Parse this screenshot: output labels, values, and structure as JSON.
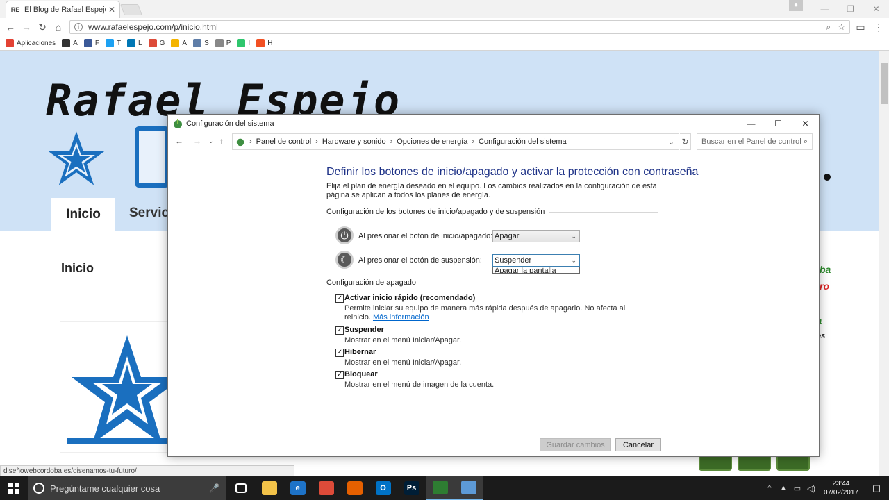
{
  "browser": {
    "tab_title": "El Blog de Rafael Espejo",
    "tab_favicon": "RE",
    "url": "www.rafaelespejo.com/p/inicio.html",
    "bookmarks": [
      {
        "label": "Aplicaciones",
        "icon": "apps-grid-icon",
        "color": "#e34234"
      },
      {
        "label": "A",
        "icon": "circle-a-icon",
        "color": "#333333"
      },
      {
        "label": "F",
        "icon": "facebook-icon",
        "color": "#3b5998"
      },
      {
        "label": "T",
        "icon": "twitter-icon",
        "color": "#1da1f2"
      },
      {
        "label": "L",
        "icon": "linkedin-icon",
        "color": "#0077b5"
      },
      {
        "label": "G",
        "icon": "google-plus-icon",
        "color": "#dd4b39"
      },
      {
        "label": "A",
        "icon": "analytics-icon",
        "color": "#f4b400"
      },
      {
        "label": "S",
        "icon": "search-console-icon",
        "color": "#5f7ea8"
      },
      {
        "label": "P",
        "icon": "page-icon",
        "color": "#888888"
      },
      {
        "label": "I",
        "icon": "pixabay-icon",
        "color": "#2ec66d"
      },
      {
        "label": "H",
        "icon": "windows-icon",
        "color": "#f25022"
      }
    ],
    "status_url": "diseñowebcordoba.es/disenamos-tu-futuro/"
  },
  "website": {
    "logo_text": "Rafael Espejo",
    "nav_active": "Inicio",
    "nav_next": "Servic",
    "page_heading": "Inicio",
    "side_text_1": "ba",
    "side_text_2": "ro",
    "side_text_3": "a",
    "side_text_4": "es"
  },
  "dialog": {
    "title": "Configuración del sistema",
    "breadcrumb": [
      "Panel de control",
      "Hardware y sonido",
      "Opciones de energía",
      "Configuración del sistema"
    ],
    "search_placeholder": "Buscar en el Panel de control",
    "heading": "Definir los botones de inicio/apagado y activar la protección con contraseña",
    "description": "Elija el plan de energía deseado en el equipo. Los cambios realizados en la configuración de esta página se aplican a todos los planes de energía.",
    "buttons_section": "Configuración de los botones de inicio/apagado y de suspensión",
    "power_button_label": "Al presionar el botón de inicio/apagado:",
    "power_button_value": "Apagar",
    "sleep_button_label": "Al presionar el botón de suspensión:",
    "sleep_button_value": "Suspender",
    "sleep_dropdown_next_option": "Apagar la pantalla",
    "shutdown_section": "Configuración de apagado",
    "options": [
      {
        "label": "Activar inicio rápido (recomendado)",
        "desc": "Permite iniciar su equipo de manera más rápida después de apagarlo. No afecta al reinicio.",
        "link": "Más información",
        "checked": true
      },
      {
        "label": "Suspender",
        "desc": "Mostrar en el menú Iniciar/Apagar.",
        "checked": true
      },
      {
        "label": "Hibernar",
        "desc": "Mostrar en el menú Iniciar/Apagar.",
        "checked": true
      },
      {
        "label": "Bloquear",
        "desc": "Mostrar en el menú de imagen de la cuenta.",
        "checked": true
      }
    ],
    "save_label": "Guardar cambios",
    "cancel_label": "Cancelar"
  },
  "taskbar": {
    "search_placeholder": "Pregúntame cualquier cosa",
    "apps": [
      {
        "label": "",
        "icon": "task-view-icon",
        "color": "#1b1b1b"
      },
      {
        "label": "",
        "icon": "file-explorer-icon",
        "color": "#f2c249"
      },
      {
        "label": "e",
        "icon": "edge-icon",
        "color": "#1e73c8"
      },
      {
        "label": "",
        "icon": "chrome-icon",
        "color": "#dd4b39"
      },
      {
        "label": "",
        "icon": "firefox-icon",
        "color": "#e66000"
      },
      {
        "label": "O",
        "icon": "outlook-icon",
        "color": "#0072c6"
      },
      {
        "label": "Ps",
        "icon": "photoshop-icon",
        "color": "#001e36"
      },
      {
        "label": "",
        "icon": "recycle-app-icon",
        "color": "#2e7d32"
      },
      {
        "label": "",
        "icon": "control-panel-icon",
        "color": "#5d9ad6"
      }
    ],
    "time": "23:44",
    "date": "07/02/2017"
  }
}
